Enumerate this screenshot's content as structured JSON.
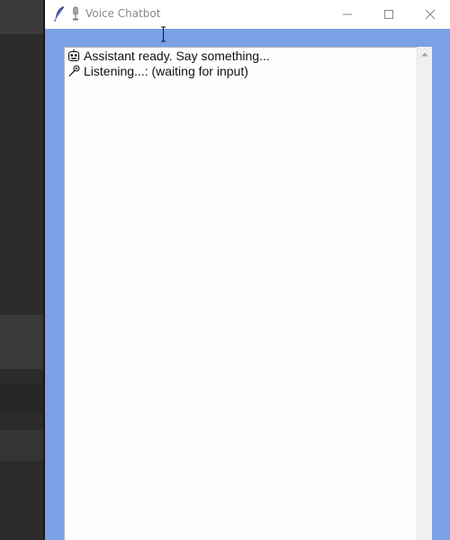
{
  "window": {
    "title": "Voice Chatbot",
    "title_icon": "microphone-icon",
    "app_icon": "feather-icon",
    "buttons": [
      "minimize",
      "maximize",
      "close"
    ]
  },
  "chat": {
    "lines": [
      {
        "icon": "robot-icon",
        "text": "Assistant ready. Say something..."
      },
      {
        "icon": "microphone-icon",
        "text": "Listening...: (waiting for input)"
      }
    ]
  },
  "colors": {
    "window_background": "#7ba0e6",
    "chat_background": "#fefefe",
    "title_text": "#8a8a8a",
    "background_app": "#2b2b2b"
  }
}
